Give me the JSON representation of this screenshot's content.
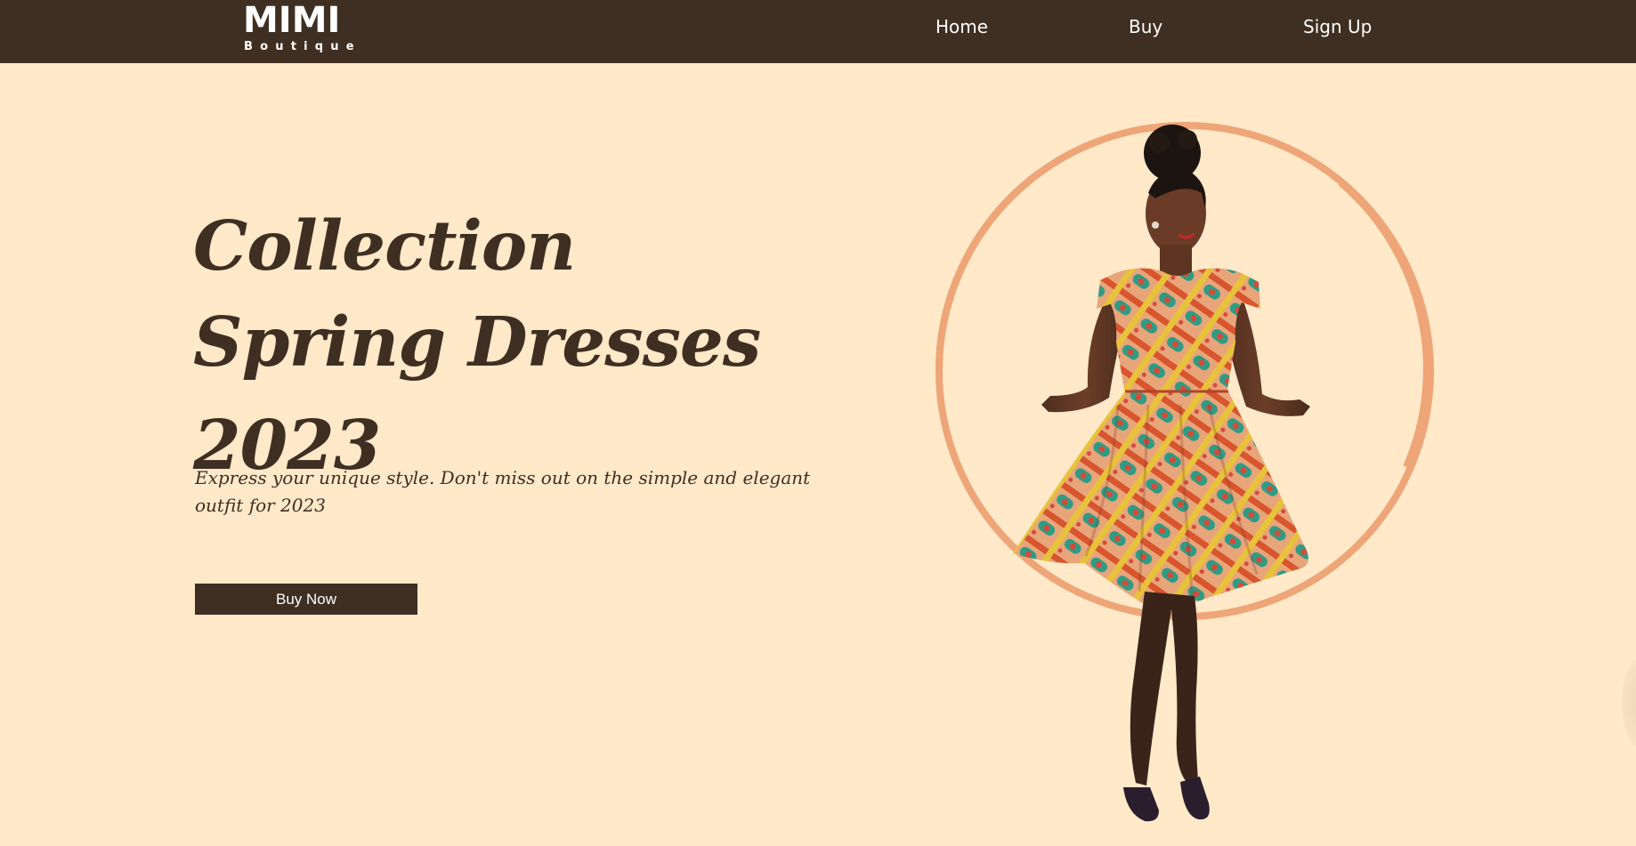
{
  "brand": {
    "name": "MIMI",
    "tagline": "Boutique"
  },
  "nav": {
    "items": [
      {
        "label": "Home"
      },
      {
        "label": "Buy"
      },
      {
        "label": "Sign Up"
      }
    ]
  },
  "hero": {
    "title_lines": [
      "Collection",
      "Spring Dresses",
      "2023"
    ],
    "subtitle": "Express your unique style. Don't miss out on the simple and elegant outfit for 2023",
    "cta_label": "Buy Now"
  },
  "colors": {
    "background": "#FFE9C9",
    "navbar": "#3F2F22",
    "text_dark": "#3F2F22",
    "circle_ring": "#EEA577"
  }
}
